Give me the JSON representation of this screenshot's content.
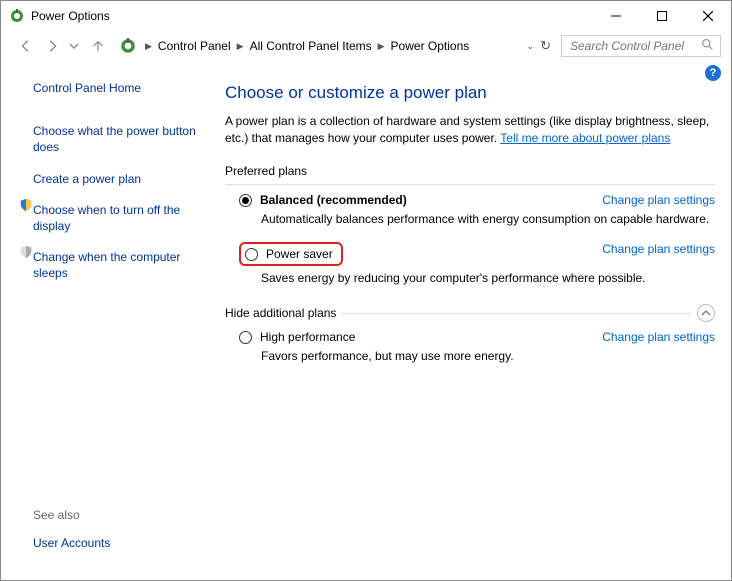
{
  "window": {
    "title": "Power Options"
  },
  "breadcrumb": {
    "items": [
      "Control Panel",
      "All Control Panel Items",
      "Power Options"
    ]
  },
  "search": {
    "placeholder": "Search Control Panel"
  },
  "sidebar": {
    "home": "Control Panel Home",
    "links": [
      "Choose what the power button does",
      "Create a power plan",
      "Choose when to turn off the display",
      "Change when the computer sleeps"
    ],
    "see_also_label": "See also",
    "bottom_link": "User Accounts"
  },
  "main": {
    "heading": "Choose or customize a power plan",
    "description_prefix": "A power plan is a collection of hardware and system settings (like display brightness, sleep, etc.) that manages how your computer uses power. ",
    "description_link": "Tell me more about power plans",
    "preferred_label": "Preferred plans",
    "hide_label": "Hide additional plans",
    "change_link": "Change plan settings",
    "plans": {
      "balanced": {
        "name": "Balanced (recommended)",
        "desc": "Automatically balances performance with energy consumption on capable hardware."
      },
      "saver": {
        "name": "Power saver",
        "desc": "Saves energy by reducing your computer's performance where possible."
      },
      "high": {
        "name": "High performance",
        "desc": "Favors performance, but may use more energy."
      }
    }
  }
}
